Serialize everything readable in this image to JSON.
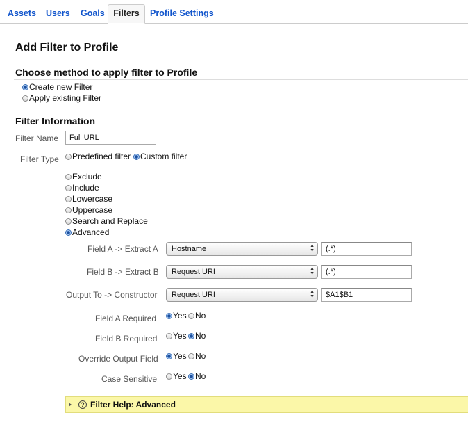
{
  "tabs": [
    {
      "label": "Assets"
    },
    {
      "label": "Users"
    },
    {
      "label": "Goals"
    },
    {
      "label": "Filters",
      "active": true
    },
    {
      "label": "Profile Settings"
    }
  ],
  "page_title": "Add Filter to Profile",
  "method": {
    "title": "Choose method to apply filter to Profile",
    "options": [
      {
        "label": "Create new Filter",
        "selected": true
      },
      {
        "label": "Apply existing Filter",
        "selected": false
      }
    ]
  },
  "filter_info": {
    "title": "Filter Information",
    "name_label": "Filter Name",
    "name_value": "Full URL",
    "type_label": "Filter Type",
    "type_options": [
      {
        "label": "Predefined filter",
        "selected": false
      },
      {
        "label": "Custom filter",
        "selected": true
      }
    ],
    "custom_options": [
      {
        "label": "Exclude",
        "selected": false
      },
      {
        "label": "Include",
        "selected": false
      },
      {
        "label": "Lowercase",
        "selected": false
      },
      {
        "label": "Uppercase",
        "selected": false
      },
      {
        "label": "Search and Replace",
        "selected": false
      },
      {
        "label": "Advanced",
        "selected": true
      }
    ]
  },
  "advanced": {
    "field_a": {
      "label": "Field A -> Extract A",
      "select": "Hostname",
      "value": "(.*)"
    },
    "field_b": {
      "label": "Field B -> Extract B",
      "select": "Request URI",
      "value": "(.*)"
    },
    "output": {
      "label": "Output To -> Constructor",
      "select": "Request URI",
      "value": "$A1$B1"
    },
    "field_a_required": {
      "label": "Field A Required",
      "yes": "Yes",
      "no": "No",
      "selected": "yes"
    },
    "field_b_required": {
      "label": "Field B Required",
      "yes": "Yes",
      "no": "No",
      "selected": "no"
    },
    "override_output": {
      "label": "Override Output Field",
      "yes": "Yes",
      "no": "No",
      "selected": "yes"
    },
    "case_sensitive": {
      "label": "Case Sensitive",
      "yes": "Yes",
      "no": "No",
      "selected": "no"
    }
  },
  "help": {
    "label": "Filter Help: Advanced"
  },
  "icons": {
    "help": "question-circle-icon",
    "expand": "triangle-right-icon"
  },
  "colors": {
    "link": "#1155cc",
    "help_bg": "#fbf7a8",
    "radio_selected": "#1b4f9e"
  }
}
